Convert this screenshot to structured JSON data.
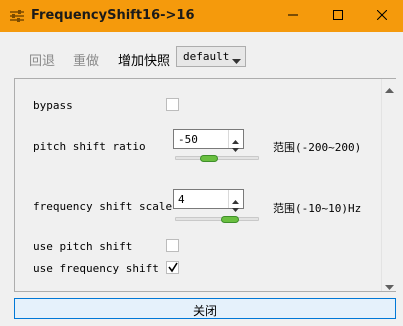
{
  "window": {
    "title": "FrequencyShift16->16",
    "accent_color": "#f59a0c",
    "icons": {
      "app": "sliders-icon",
      "minimize": "minimize-icon",
      "maximize": "maximize-icon",
      "close": "close-icon"
    }
  },
  "toolbar": {
    "undo_label": "回退",
    "redo_label": "重做",
    "add_preset_label": "增加快照",
    "preset_value": "default"
  },
  "params": {
    "bypass": {
      "label": "bypass",
      "checked": false
    },
    "pitch_shift_ratio": {
      "label": "pitch shift ratio",
      "value": "-50",
      "range_text": "范围(-200~200)",
      "slider_fraction": 0.375
    },
    "frequency_shift_scale": {
      "label": "frequency shift scale",
      "value": "4",
      "range_text": "范围(-10~10)Hz",
      "slider_fraction": 0.7
    },
    "use_pitch_shift": {
      "label": "use pitch shift",
      "checked": false
    },
    "use_frequency_shift": {
      "label": "use frequency shift",
      "checked": true
    }
  },
  "footer": {
    "close_label": "关闭"
  }
}
